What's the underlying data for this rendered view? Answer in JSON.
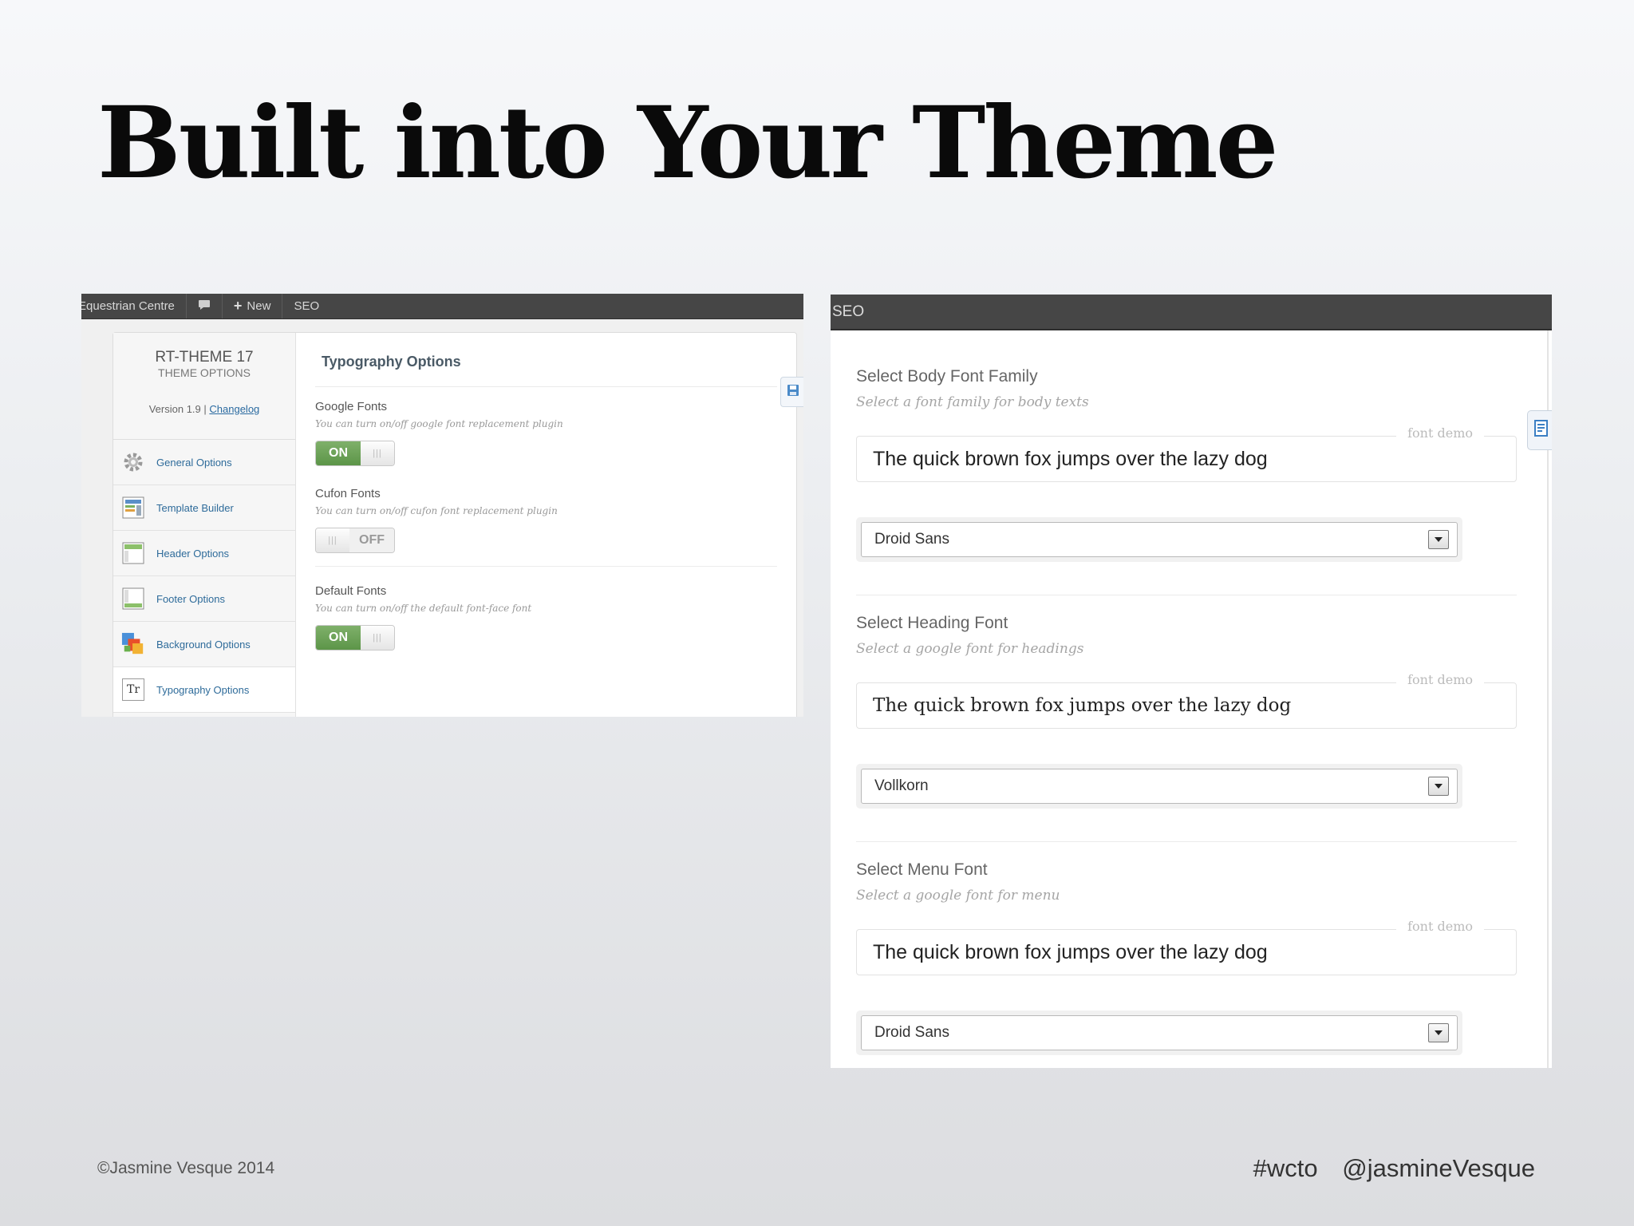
{
  "slide": {
    "title": "Built into Your Theme",
    "copyright": "©Jasmine Vesque 2014",
    "hashtag": "#wcto",
    "handle": "@jasmineVesque"
  },
  "left_screenshot": {
    "admin_bar": {
      "site_name": "Equestrian Centre",
      "new_label": "New",
      "seo_label": "SEO"
    },
    "brand": {
      "title": "RT-THEME 17",
      "subtitle": "THEME OPTIONS",
      "version": "Version 1.9 |",
      "changelog": "Changelog"
    },
    "menu": [
      {
        "label": "General Options",
        "icon": "gear-icon"
      },
      {
        "label": "Template Builder",
        "icon": "template-icon"
      },
      {
        "label": "Header Options",
        "icon": "header-icon"
      },
      {
        "label": "Footer Options",
        "icon": "footer-icon"
      },
      {
        "label": "Background Options",
        "icon": "background-icon"
      },
      {
        "label": "Typography Options",
        "icon": "typography-icon",
        "icon_text": "Tr"
      }
    ],
    "heading": "Typography Options",
    "options": [
      {
        "label": "Google Fonts",
        "desc": "You can turn on/off google font replacement plugin",
        "state": "ON"
      },
      {
        "label": "Cufon Fonts",
        "desc": "You can turn on/off cufon font replacement plugin",
        "state": "OFF"
      },
      {
        "label": "Default Fonts",
        "desc": "You can turn on/off the default font-face font",
        "state": "ON"
      }
    ]
  },
  "right_screenshot": {
    "bar_title": "SEO",
    "demo_tag": "font demo",
    "sections": [
      {
        "label": "Select Body Font Family",
        "desc": "Select a font family for body texts",
        "demo": "The quick brown fox jumps over the lazy dog",
        "selected": "Droid Sans"
      },
      {
        "label": "Select Heading Font",
        "desc": "Select a google font for headings",
        "demo": "The quick brown fox jumps over the lazy dog",
        "selected": "Vollkorn"
      },
      {
        "label": "Select Menu Font",
        "desc": "Select a google font for menu",
        "demo": "The quick brown fox jumps over the lazy dog",
        "selected": "Droid Sans"
      }
    ]
  }
}
